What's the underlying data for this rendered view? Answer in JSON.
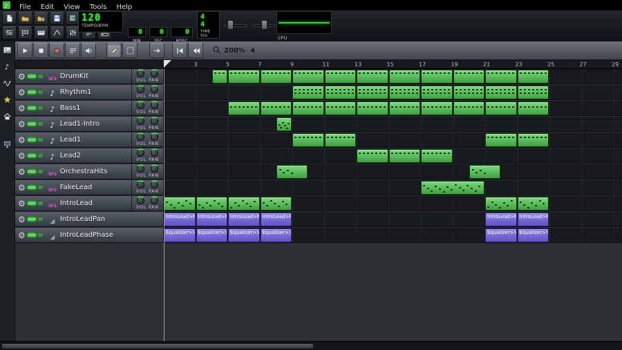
{
  "app": {
    "name": "LMMS"
  },
  "menu": {
    "items": [
      "File",
      "Edit",
      "View",
      "Tools",
      "Help"
    ]
  },
  "colors": {
    "pattern_green": "#5cc25c",
    "automation_purple": "#7a68d8",
    "lcd_green": "#3fe43f"
  },
  "toolbar": {
    "row1": [
      {
        "name": "new-project-button",
        "icon": "page"
      },
      {
        "name": "open-project-button",
        "icon": "folder"
      },
      {
        "name": "recent-projects-button",
        "icon": "folderclock"
      },
      {
        "name": "save-project-button",
        "icon": "floppy"
      },
      {
        "name": "export-project-button",
        "icon": "export"
      }
    ],
    "row2": [
      {
        "name": "song-editor-toggle",
        "icon": "songgrid"
      },
      {
        "name": "bb-editor-toggle",
        "icon": "beatgrid"
      },
      {
        "name": "piano-roll-toggle",
        "icon": "piano"
      },
      {
        "name": "automation-editor-toggle",
        "icon": "curve"
      },
      {
        "name": "fx-mixer-toggle",
        "icon": "mixer"
      },
      {
        "name": "project-notes-toggle",
        "icon": "noteslines"
      },
      {
        "name": "controller-rack-toggle",
        "icon": "rack"
      }
    ],
    "tempo": {
      "value": "120",
      "label": "TEMPO/BPM"
    },
    "time": {
      "min": "0",
      "sec": "0",
      "msec": "0",
      "min_label": "MIN",
      "sec_label": "SEC",
      "msec_label": "MSEC"
    },
    "time_sig": {
      "numerator": "4",
      "denominator": "4",
      "label": "TIME SIG"
    },
    "cpu": {
      "label": "CPU"
    }
  },
  "sidebar": {
    "items": [
      {
        "name": "sidebar-instruments",
        "icon": "image"
      },
      {
        "name": "sidebar-my-projects",
        "icon": "noteicon"
      },
      {
        "name": "sidebar-samples",
        "icon": "wave"
      },
      {
        "name": "sidebar-presets",
        "icon": "star"
      },
      {
        "name": "sidebar-home",
        "icon": "home"
      },
      {
        "name": "sidebar-computer",
        "icon": "computer",
        "gap": true
      }
    ]
  },
  "editor": {
    "zoom": "200%",
    "knob_label": "VOL PAN",
    "buttons": [
      {
        "name": "play-button",
        "icon": "play"
      },
      {
        "name": "stop-button",
        "icon": "stop"
      },
      {
        "name": "record-button",
        "icon": "record"
      },
      {
        "name": "loop-marker-button",
        "icon": "looplines"
      },
      {
        "name": "metronome-button",
        "icon": "speaker"
      },
      {
        "name": "draw-mode-button",
        "icon": "pencil",
        "active": true
      },
      {
        "name": "edit-mode-button",
        "icon": "select"
      },
      {
        "name": "forward-button",
        "icon": "arrowright"
      },
      {
        "name": "back-to-start-button",
        "icon": "tostart"
      },
      {
        "name": "rewind-button",
        "icon": "prevbars"
      }
    ]
  },
  "timeline": {
    "numbers": [
      3,
      5,
      7,
      9,
      11,
      13,
      15,
      17,
      19,
      21,
      23,
      25,
      27,
      29
    ]
  },
  "tracks": [
    {
      "name": "DrumKit",
      "icon": "sf2",
      "knobs": true,
      "segments": [
        {
          "bar": 4,
          "len": 1,
          "type": "pattern",
          "notes": "drums"
        },
        {
          "bar": 5,
          "len": 2,
          "type": "pattern",
          "notes": "drums"
        },
        {
          "bar": 7,
          "len": 2,
          "type": "pattern",
          "notes": "drums"
        },
        {
          "bar": 9,
          "len": 2,
          "type": "pattern",
          "notes": "drums"
        },
        {
          "bar": 11,
          "len": 2,
          "type": "pattern",
          "notes": "drums"
        },
        {
          "bar": 13,
          "len": 2,
          "type": "pattern",
          "notes": "drums"
        },
        {
          "bar": 15,
          "len": 2,
          "type": "pattern",
          "notes": "drums"
        },
        {
          "bar": 17,
          "len": 2,
          "type": "pattern",
          "notes": "drums"
        },
        {
          "bar": 19,
          "len": 2,
          "type": "pattern",
          "notes": "drums"
        },
        {
          "bar": 21,
          "len": 2,
          "type": "pattern",
          "notes": "drums"
        },
        {
          "bar": 23,
          "len": 2,
          "type": "pattern",
          "notes": "drums"
        }
      ]
    },
    {
      "name": "Rhythm1",
      "icon": "note",
      "knobs": true,
      "segments": [
        {
          "bar": 9,
          "len": 2,
          "type": "pattern",
          "notes": "chords"
        },
        {
          "bar": 11,
          "len": 2,
          "type": "pattern",
          "notes": "chords"
        },
        {
          "bar": 13,
          "len": 2,
          "type": "pattern",
          "notes": "chords"
        },
        {
          "bar": 15,
          "len": 2,
          "type": "pattern",
          "notes": "chords"
        },
        {
          "bar": 17,
          "len": 2,
          "type": "pattern",
          "notes": "chords"
        },
        {
          "bar": 19,
          "len": 2,
          "type": "pattern",
          "notes": "chords"
        },
        {
          "bar": 21,
          "len": 2,
          "type": "pattern",
          "notes": "chords"
        },
        {
          "bar": 23,
          "len": 2,
          "type": "pattern",
          "notes": "chords"
        }
      ]
    },
    {
      "name": "Bass1",
      "icon": "note",
      "knobs": true,
      "segments": [
        {
          "bar": 5,
          "len": 2,
          "type": "pattern",
          "notes": "bass"
        },
        {
          "bar": 7,
          "len": 2,
          "type": "pattern",
          "notes": "bass"
        },
        {
          "bar": 9,
          "len": 2,
          "type": "pattern",
          "notes": "bass"
        },
        {
          "bar": 11,
          "len": 2,
          "type": "pattern",
          "notes": "bass"
        },
        {
          "bar": 13,
          "len": 2,
          "type": "pattern",
          "notes": "bass"
        },
        {
          "bar": 15,
          "len": 2,
          "type": "pattern",
          "notes": "bass"
        },
        {
          "bar": 17,
          "len": 2,
          "type": "pattern",
          "notes": "bass"
        },
        {
          "bar": 19,
          "len": 2,
          "type": "pattern",
          "notes": "bass"
        },
        {
          "bar": 21,
          "len": 2,
          "type": "pattern",
          "notes": "bass"
        },
        {
          "bar": 23,
          "len": 2,
          "type": "pattern",
          "notes": "bass"
        }
      ]
    },
    {
      "name": "Lead1-Intro",
      "icon": "note",
      "knobs": true,
      "segments": [
        {
          "bar": 8,
          "len": 1,
          "type": "pattern",
          "notes": "melody"
        }
      ]
    },
    {
      "name": "Lead1",
      "icon": "note",
      "knobs": true,
      "segments": [
        {
          "bar": 9,
          "len": 2,
          "type": "pattern",
          "notes": "line"
        },
        {
          "bar": 11,
          "len": 2,
          "type": "pattern",
          "notes": "line"
        },
        {
          "bar": 21,
          "len": 2,
          "type": "pattern",
          "notes": "line"
        },
        {
          "bar": 23,
          "len": 2,
          "type": "pattern",
          "notes": "line"
        }
      ]
    },
    {
      "name": "Lead2",
      "icon": "note",
      "knobs": true,
      "segments": [
        {
          "bar": 13,
          "len": 2,
          "type": "pattern",
          "notes": "line"
        },
        {
          "bar": 15,
          "len": 2,
          "type": "pattern",
          "notes": "line"
        },
        {
          "bar": 17,
          "len": 2,
          "type": "pattern",
          "notes": "line"
        }
      ]
    },
    {
      "name": "OrchestraHits",
      "icon": "sf2",
      "knobs": true,
      "segments": [
        {
          "bar": 8,
          "len": 2,
          "type": "pattern",
          "notes": "sparse"
        },
        {
          "bar": 20,
          "len": 2,
          "type": "pattern",
          "notes": "sparse"
        }
      ]
    },
    {
      "name": "FakeLead",
      "icon": "sf2",
      "knobs": true,
      "segments": [
        {
          "bar": 17,
          "len": 4,
          "type": "pattern",
          "notes": "melody"
        }
      ]
    },
    {
      "name": "IntroLead",
      "icon": "sf2",
      "knobs": true,
      "segments": [
        {
          "bar": 1,
          "len": 2,
          "type": "pattern",
          "notes": "melody"
        },
        {
          "bar": 3,
          "len": 2,
          "type": "pattern",
          "notes": "melody"
        },
        {
          "bar": 5,
          "len": 2,
          "type": "pattern",
          "notes": "melody"
        },
        {
          "bar": 7,
          "len": 2,
          "type": "pattern",
          "notes": "melody"
        },
        {
          "bar": 21,
          "len": 2,
          "type": "pattern",
          "notes": "melody"
        },
        {
          "bar": 23,
          "len": 2,
          "type": "pattern",
          "notes": "melody"
        }
      ]
    },
    {
      "name": "IntroLeadPan",
      "icon": "automation",
      "knobs": false,
      "segments": [
        {
          "bar": 1,
          "len": 2,
          "type": "automation",
          "label": "IntroLead>P"
        },
        {
          "bar": 3,
          "len": 2,
          "type": "automation",
          "label": "IntroLead>P"
        },
        {
          "bar": 5,
          "len": 2,
          "type": "automation",
          "label": "IntroLead>P"
        },
        {
          "bar": 7,
          "len": 2,
          "type": "automation",
          "label": "IntroLead>P"
        },
        {
          "bar": 21,
          "len": 2,
          "type": "automation",
          "label": "IntroLead>P"
        },
        {
          "bar": 23,
          "len": 2,
          "type": "automation",
          "label": "IntroLead>P"
        }
      ]
    },
    {
      "name": "IntroLeadPhase",
      "icon": "automation",
      "knobs": false,
      "segments": [
        {
          "bar": 1,
          "len": 2,
          "type": "automation",
          "label": "Equalizer>>|"
        },
        {
          "bar": 3,
          "len": 2,
          "type": "automation",
          "label": "Equalizer>>|"
        },
        {
          "bar": 5,
          "len": 2,
          "type": "automation",
          "label": "Equalizer>>|"
        },
        {
          "bar": 7,
          "len": 2,
          "type": "automation",
          "label": "Equalizer>>|"
        },
        {
          "bar": 21,
          "len": 2,
          "type": "automation",
          "label": "Equalizer>>|"
        },
        {
          "bar": 23,
          "len": 2,
          "type": "automation",
          "label": "Equalizer>>|"
        }
      ]
    }
  ]
}
